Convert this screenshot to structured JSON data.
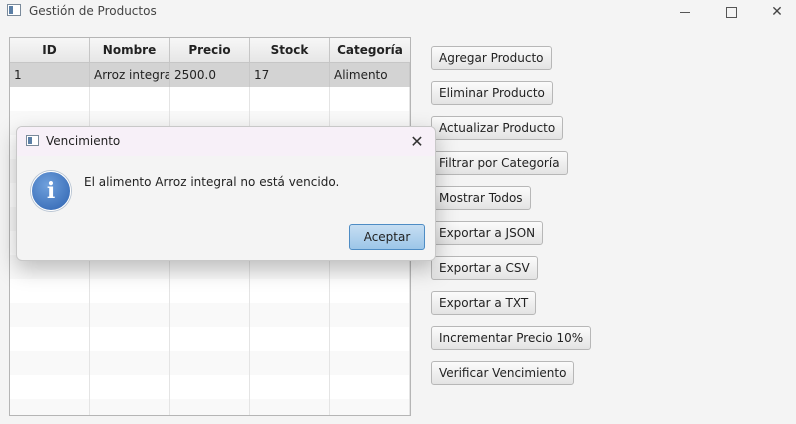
{
  "window": {
    "title": "Gestión de Productos",
    "controls": {
      "minimize": "minimize",
      "maximize": "maximize",
      "close": "✕"
    }
  },
  "table": {
    "columns": [
      "ID",
      "Nombre",
      "Precio",
      "Stock",
      "Categoría"
    ],
    "rows": [
      [
        "1",
        "Arroz integral",
        "2500.0",
        "17",
        "Alimento"
      ]
    ]
  },
  "actions": [
    "Agregar Producto",
    "Eliminar Producto",
    "Actualizar Producto",
    "Filtrar por Categoría",
    "Mostrar Todos",
    "Exportar a JSON",
    "Exportar a CSV",
    "Exportar a TXT",
    "Incrementar Precio 10%",
    "Verificar Vencimiento"
  ],
  "dialog": {
    "title": "Vencimiento",
    "close_glyph": "✕",
    "icon_glyph": "i",
    "message": "El alimento Arroz integral no está vencido.",
    "ok_label": "Aceptar"
  },
  "colors": {
    "accent_button": "#9cc6e8",
    "info_icon": "#2d62b0",
    "selected_row": "#d3d3d3"
  }
}
